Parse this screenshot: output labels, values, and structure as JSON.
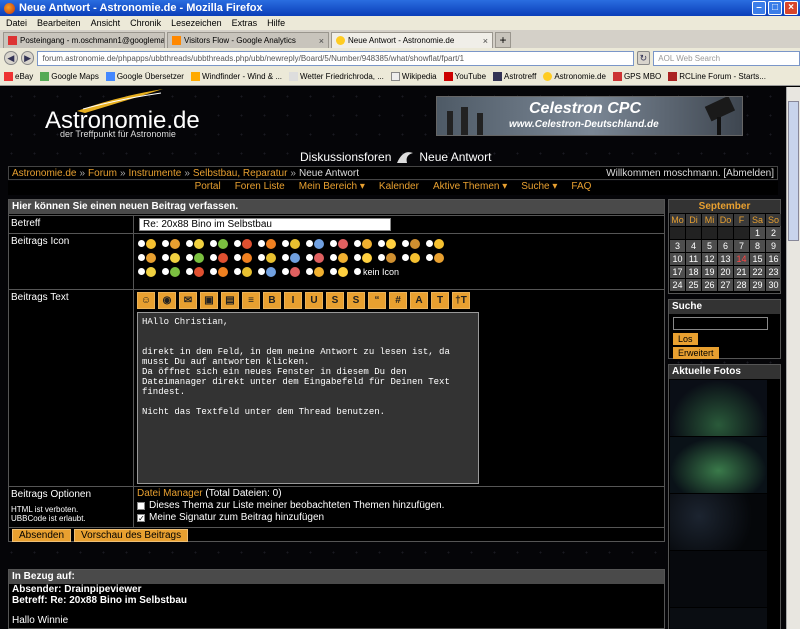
{
  "window": {
    "title": "Neue Antwort - Astronomie.de - Mozilla Firefox"
  },
  "menu": [
    "Datei",
    "Bearbeiten",
    "Ansicht",
    "Chronik",
    "Lesezeichen",
    "Extras",
    "Hilfe"
  ],
  "tabs": [
    {
      "label": "Posteingang - m.oschmann1@googlemail....",
      "active": false
    },
    {
      "label": "Visitors Flow - Google Analytics",
      "active": false
    },
    {
      "label": "Neue Antwort - Astronomie.de",
      "active": true
    }
  ],
  "address": {
    "url": "forum.astronomie.de/phpapps/ubbthreads/ubbthreads.php/ubb/newreply/Board/5/Number/948385/what/showflat/fpart/1",
    "search_placeholder": "AOL Web Search"
  },
  "bookmarks": [
    "eBay",
    "Google Maps",
    "Google Übersetzer",
    "Windfinder - Wind & ...",
    "Wetter Friedrichroda, ...",
    "Wikipedia",
    "YouTube",
    "Astrotreff",
    "Astronomie.de",
    "GPS MBO",
    "RCLine Forum - Starts..."
  ],
  "site": {
    "logo_name": "Astronomie.de",
    "logo_sub": "der Treffpunkt für Astronomie",
    "banner_title": "Celestron CPC",
    "banner_url": "www.Celestron-Deutschland.de",
    "forum_title_left": "Diskussionsforen",
    "forum_title_right": "Neue Antwort"
  },
  "breadcrumb": {
    "items": [
      "Astronomie.de",
      "Forum",
      "Instrumente",
      "Selbstbau, Reparatur"
    ],
    "current": "Neue Antwort",
    "welcome": "Willkommen moschmann. [Abmelden]"
  },
  "topnav": [
    "Portal",
    "Foren Liste",
    "Mein Bereich ▾",
    "Kalender",
    "Aktive Themen ▾",
    "Suche ▾",
    "FAQ"
  ],
  "form": {
    "heading": "Hier können Sie einen neuen Beitrag verfassen.",
    "betreff_label": "Betreff",
    "betreff_value": "Re: 20x88 Bino im Selbstbau",
    "icon_label": "Beitrags Icon",
    "kein_icon": "kein Icon",
    "text_label": "Beitrags Text",
    "toolbar": [
      "☺",
      "◉",
      "✉",
      "▣",
      "▤",
      "≡",
      "B",
      "I",
      "U",
      "S",
      "S",
      "“",
      "#",
      "A",
      "T",
      "†T"
    ],
    "body": "HAllo Christian,\n\n\ndirekt in dem Feld, in dem meine Antwort zu lesen ist, da musst Du auf antworten klicken.\nDa öffnet sich ein neues Fenster in diesem Du den Dateimanager direkt unter dem Eingabefeld für Deinen Text findest.\n\nNicht das Textfeld unter dem Thread benutzen.",
    "options_label": "Beitrags Optionen",
    "html_note": "HTML ist verboten.",
    "ubb_note": "UBBCode ist erlaubt.",
    "dateimanager_link": "Datei Manager",
    "dateimanager_count": "(Total Dateien: 0)",
    "opt_watch": "Dieses Thema zur Liste meiner beobachteten Themen hinzufügen.",
    "opt_signature": "Meine Signatur zum Beitrag hinzufügen",
    "submit": "Absenden",
    "preview": "Vorschau des Beitrags"
  },
  "calendar": {
    "month": "September",
    "weekdays": [
      "Mo",
      "Di",
      "Mi",
      "Do",
      "F",
      "Sa",
      "So"
    ],
    "days": [
      "",
      "",
      "",
      "",
      "",
      "1",
      "2",
      "3",
      "4",
      "5",
      "6",
      "7",
      "8",
      "9",
      "10",
      "11",
      "12",
      "13",
      "14",
      "15",
      "16",
      "17",
      "18",
      "19",
      "20",
      "21",
      "22",
      "23",
      "24",
      "25",
      "26",
      "27",
      "28",
      "29",
      "30"
    ],
    "today": "14"
  },
  "suche": {
    "title": "Suche",
    "go": "Los",
    "advanced": "Erweitert"
  },
  "fotos": {
    "title": "Aktuelle Fotos"
  },
  "bezug": {
    "heading": "In Bezug auf:",
    "absender": "Absender: Drainpipeviewer",
    "betreff": "Betreff: Re: 20x88 Bino im Selbstbau",
    "body_start": "Hallo Winnie"
  },
  "colors": {
    "accent": "#e8a030",
    "background": "#000000",
    "header": "#4a4a4a"
  }
}
